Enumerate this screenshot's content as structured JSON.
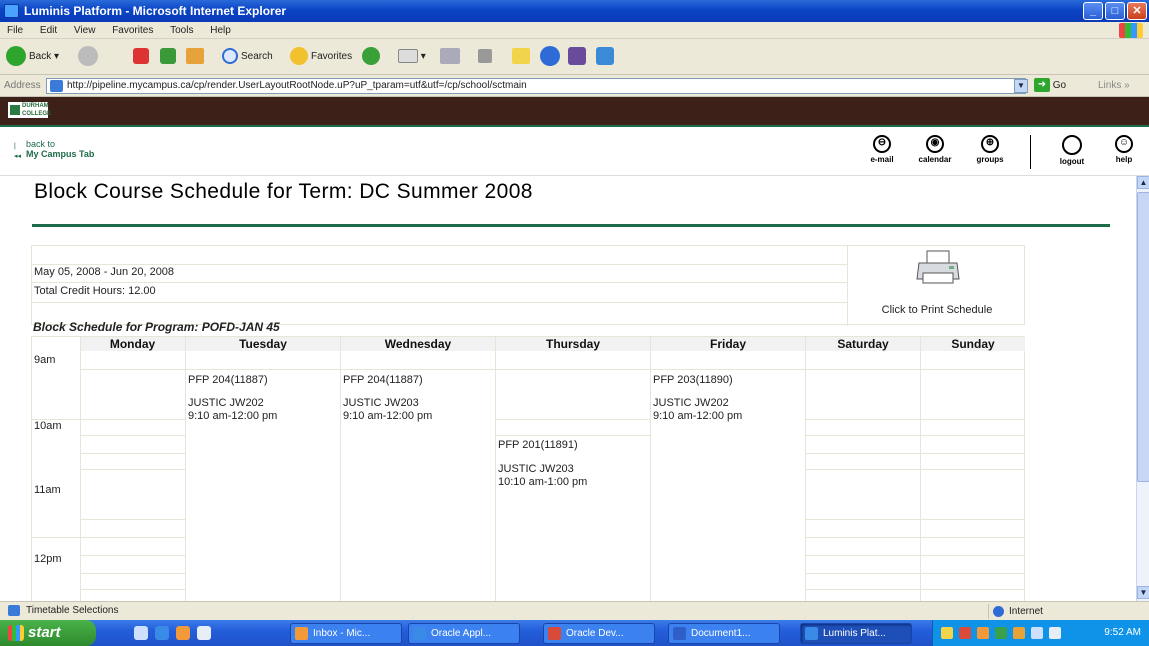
{
  "window": {
    "title": "Luminis Platform - Microsoft Internet Explorer"
  },
  "menu": [
    "File",
    "Edit",
    "View",
    "Favorites",
    "Tools",
    "Help"
  ],
  "toolbar": {
    "back": "Back",
    "search": "Search",
    "favorites": "Favorites"
  },
  "address": {
    "label": "Address",
    "url": "http://pipeline.mycampus.ca/cp/render.UserLayoutRootNode.uP?uP_tparam=utf&utf=/cp/school/sctmain",
    "go": "Go",
    "links": "Links"
  },
  "brand": {
    "logo_text": "DURHAM COLLEGE"
  },
  "portal": {
    "back_to": "back to",
    "back_target": "My Campus Tab",
    "nav": [
      {
        "label": "e-mail",
        "icon": "e-mail-icon"
      },
      {
        "label": "calendar",
        "icon": "calendar-icon"
      },
      {
        "label": "groups",
        "icon": "groups-icon"
      },
      {
        "label": "logout",
        "icon": "logout-icon"
      },
      {
        "label": "help",
        "icon": "help-icon"
      }
    ]
  },
  "page": {
    "title": "Block Course Schedule for Term: DC Summer 2008",
    "date_range": "May 05, 2008 - Jun 20, 2008",
    "credit_hours": "Total Credit Hours: 12.00",
    "print_label": "Click to Print Schedule",
    "program_title": "Block Schedule for Program: POFD-JAN 45"
  },
  "schedule": {
    "days": [
      "Monday",
      "Tuesday",
      "Wednesday",
      "Thursday",
      "Friday",
      "Saturday",
      "Sunday"
    ],
    "times": [
      "9am",
      "10am",
      "11am",
      "12pm"
    ],
    "blocks": [
      {
        "day": "Tuesday",
        "course": "PFP 204(11887)",
        "room": "JUSTIC JW202",
        "time": "9:10 am-12:00 pm"
      },
      {
        "day": "Wednesday",
        "course": "PFP 204(11887)",
        "room": "JUSTIC JW203",
        "time": "9:10 am-12:00 pm"
      },
      {
        "day": "Thursday",
        "course": "PFP 201(11891)",
        "room": "JUSTIC JW203",
        "time": "10:10 am-1:00 pm"
      },
      {
        "day": "Friday",
        "course": "PFP 203(11890)",
        "room": "JUSTIC JW202",
        "time": "9:10 am-12:00 pm"
      }
    ]
  },
  "status": {
    "text": "Timetable Selections",
    "zone": "Internet"
  },
  "taskbar": {
    "start": "start",
    "tasks": [
      "Inbox - Mic...",
      "Oracle Appl...",
      "Oracle Dev...",
      "Document1...",
      "Luminis Plat..."
    ],
    "clock": "9:52 AM"
  }
}
